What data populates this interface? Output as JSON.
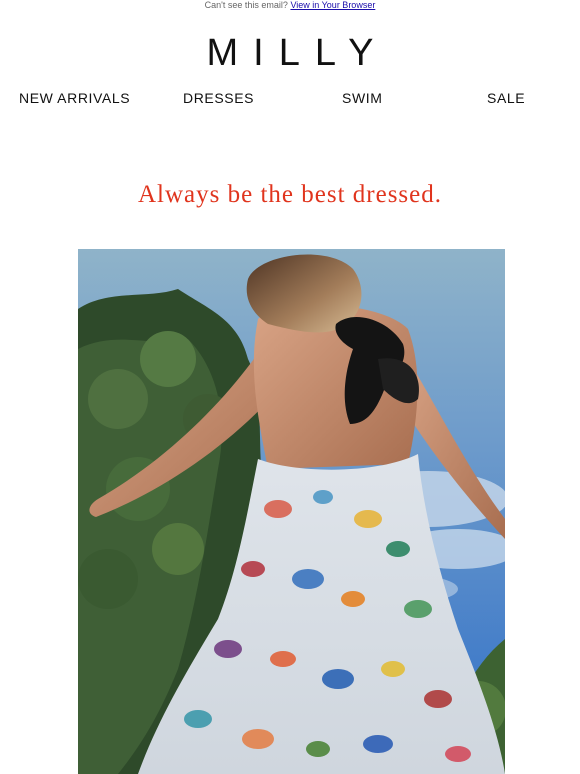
{
  "preheader": {
    "text": "Can't see this email?",
    "link_label": "View in Your Browser"
  },
  "brand": {
    "logo_text": "MILLY"
  },
  "nav": {
    "items": [
      {
        "label": "NEW ARRIVALS"
      },
      {
        "label": "DRESSES"
      },
      {
        "label": "SWIM"
      },
      {
        "label": "SALE"
      }
    ]
  },
  "hero": {
    "tagline": "Always be the best dressed.",
    "tagline_color": "#e0341d"
  }
}
